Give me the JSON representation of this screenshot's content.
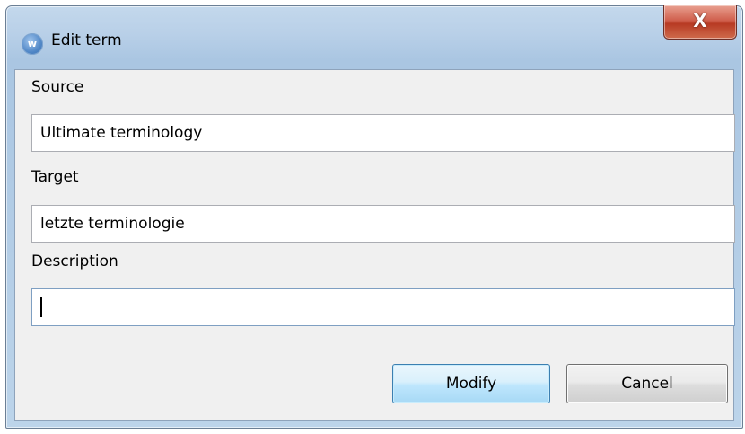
{
  "window": {
    "title": "Edit term",
    "icon": "app-logo-icon",
    "close_glyph": "X"
  },
  "form": {
    "source": {
      "label": "Source",
      "value": "Ultimate terminology"
    },
    "target": {
      "label": "Target",
      "value": "letzte terminologie"
    },
    "description": {
      "label": "Description",
      "value": ""
    }
  },
  "buttons": {
    "modify_label": "Modify",
    "cancel_label": "Cancel"
  },
  "colors": {
    "title_bar": "#b9d0e8",
    "close_button": "#c7442d",
    "default_button_border": "#3c7fb1",
    "dialog_background": "#f0f0f0"
  }
}
